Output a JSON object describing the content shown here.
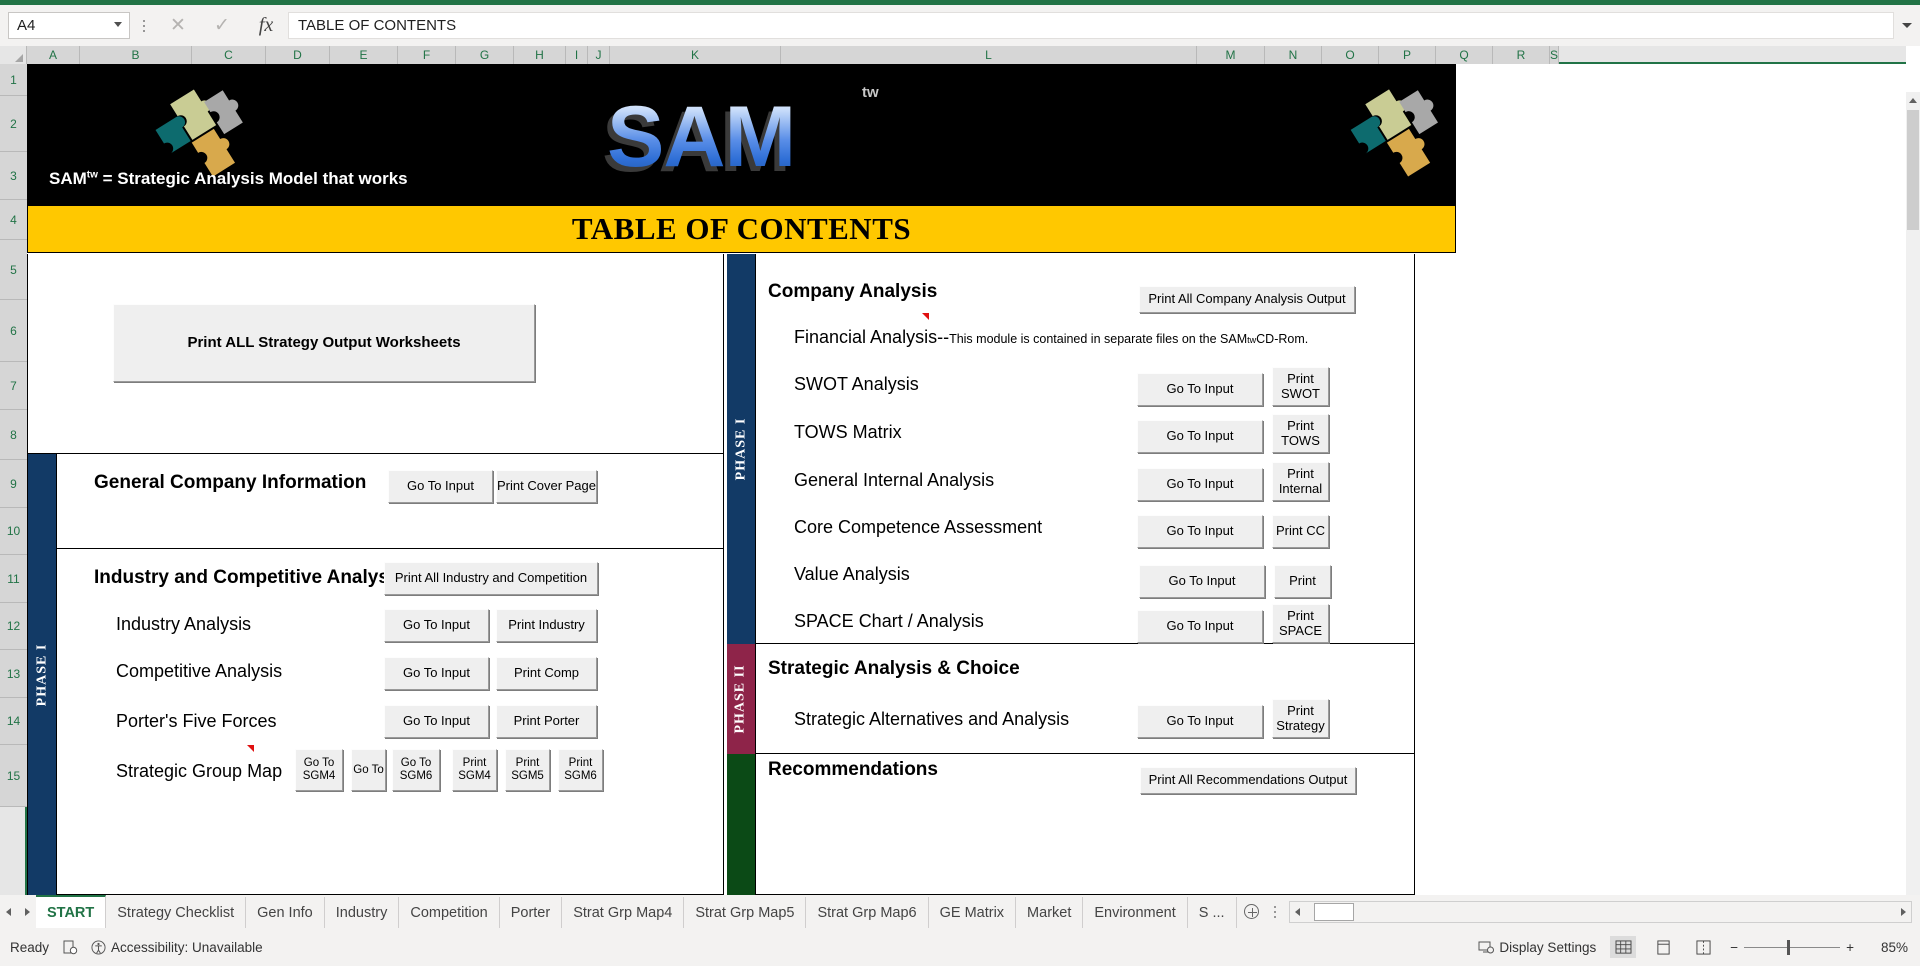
{
  "formula_bar": {
    "name_box": "A4",
    "formula": "TABLE OF CONTENTS",
    "cancel_icon": "close-icon",
    "enter_icon": "check-icon",
    "function_icon": "fx-icon"
  },
  "columns": [
    "A",
    "B",
    "C",
    "D",
    "E",
    "F",
    "G",
    "H",
    "I",
    "J",
    "K",
    "L",
    "M",
    "N",
    "O",
    "P",
    "Q",
    "R",
    "S"
  ],
  "rows": [
    "1",
    "2",
    "3",
    "4",
    "5",
    "6",
    "7",
    "8",
    "9",
    "10",
    "11",
    "12",
    "13",
    "14",
    "15"
  ],
  "banner": {
    "logo_text": "SAM",
    "logo_superscript": "tw",
    "tagline_prefix": "SAM",
    "tagline_superscript": "tw",
    "tagline_rest": " = Strategic Analysis Model that works"
  },
  "title": "TABLE OF CONTENTS",
  "left_panel": {
    "phase_label": "PHASE I",
    "print_all_button": "Print ALL Strategy Output Worksheets",
    "sections": [
      {
        "heading": "General Company Information",
        "buttons": [
          {
            "label": "Go To Input",
            "name": "go-to-input-general-company"
          },
          {
            "label": "Print Cover Page",
            "name": "print-cover-page-button"
          }
        ]
      },
      {
        "heading": "Industry and Competitive Analysis",
        "print_all": "Print All Industry and Competition",
        "items": [
          {
            "label": "Industry Analysis",
            "buttons": [
              {
                "label": "Go To Input",
                "name": "go-to-input-industry"
              },
              {
                "label": "Print Industry",
                "name": "print-industry-button"
              }
            ]
          },
          {
            "label": "Competitive Analysis",
            "buttons": [
              {
                "label": "Go To Input",
                "name": "go-to-input-competitive"
              },
              {
                "label": "Print Comp",
                "name": "print-comp-button"
              }
            ]
          },
          {
            "label": "Porter's Five Forces",
            "buttons": [
              {
                "label": "Go To Input",
                "name": "go-to-input-porter"
              },
              {
                "label": "Print Porter",
                "name": "print-porter-button"
              }
            ]
          },
          {
            "label": "Strategic Group  Map",
            "buttons": [
              {
                "label": "Go To SGM4",
                "name": "go-to-sgm4-button"
              },
              {
                "label": "Go To",
                "name": "go-to-sgm-button"
              },
              {
                "label": "Go To SGM6",
                "name": "go-to-sgm6-button"
              },
              {
                "label": "Print SGM4",
                "name": "print-sgm4-button"
              },
              {
                "label": "Print SGM5",
                "name": "print-sgm5-button"
              },
              {
                "label": "Print SGM6",
                "name": "print-sgm6-button"
              }
            ]
          }
        ]
      }
    ]
  },
  "right_panel": {
    "phase1_label": "PHASE I",
    "phase2_label": "PHASE II",
    "company_analysis": {
      "heading": "Company Analysis",
      "print_all": "Print All Company Analysis Output",
      "financial_label": "Financial Analysis--",
      "financial_note_a": "This module is contained in separate files on the SAM ",
      "financial_note_sup": "tw",
      "financial_note_b": " CD-Rom.",
      "items": [
        {
          "label": "SWOT Analysis",
          "goto": "Go To Input",
          "print": "Print\nSWOT",
          "print_l1": "Print",
          "print_l2": "SWOT"
        },
        {
          "label": "TOWS Matrix",
          "goto": "Go To Input",
          "print_l1": "Print",
          "print_l2": "TOWS"
        },
        {
          "label": "General Internal Analysis",
          "goto": "Go To Input",
          "print_l1": "Print",
          "print_l2": "Internal"
        },
        {
          "label": "Core Competence Assessment",
          "goto": "Go To Input",
          "print_l1": "Print CC",
          "print_l2": ""
        },
        {
          "label": "Value Analysis",
          "goto": "Go To Input",
          "print_l1": "Print",
          "print_l2": ""
        },
        {
          "label": "SPACE Chart / Analysis",
          "goto": "Go To Input",
          "print_l1": "Print",
          "print_l2": "SPACE"
        }
      ]
    },
    "strategic_analysis": {
      "heading": "Strategic Analysis & Choice",
      "items": [
        {
          "label": "Strategic Alternatives and Analysis",
          "goto": "Go To Input",
          "print_l1": "Print",
          "print_l2": "Strategy"
        }
      ]
    },
    "recommendations": {
      "heading": "Recommendations",
      "print_all": "Print All Recommendations Output"
    }
  },
  "sheet_tabs": {
    "active": "START",
    "tabs": [
      "START",
      "Strategy Checklist",
      "Gen Info",
      "Industry",
      "Competition",
      "Porter",
      "Strat Grp Map4",
      "Strat Grp Map5",
      "Strat Grp Map6",
      "GE Matrix",
      "Market",
      "Environment",
      "S ..."
    ],
    "add_sheet_icon": "add-sheet-icon"
  },
  "status_bar": {
    "state": "Ready",
    "macro_icon": "macro-record-icon",
    "accessibility_icon": "accessibility-icon",
    "accessibility": "Accessibility: Unavailable",
    "display_settings": "Display Settings",
    "display_settings_icon": "display-settings-icon",
    "view_normal_icon": "normal-view-icon",
    "view_pagelayout_icon": "page-layout-view-icon",
    "view_pagebreak_icon": "page-break-view-icon",
    "zoom_out": "−",
    "zoom_in": "+",
    "zoom": "85%"
  },
  "colors": {
    "excel_green": "#217346",
    "banner_black": "#000000",
    "title_yellow": "#ffc800",
    "phase1_navy": "#123a66",
    "phase2_maroon": "#8e2449",
    "recommend_green": "#0b4a16",
    "comment_red": "#e01010"
  }
}
